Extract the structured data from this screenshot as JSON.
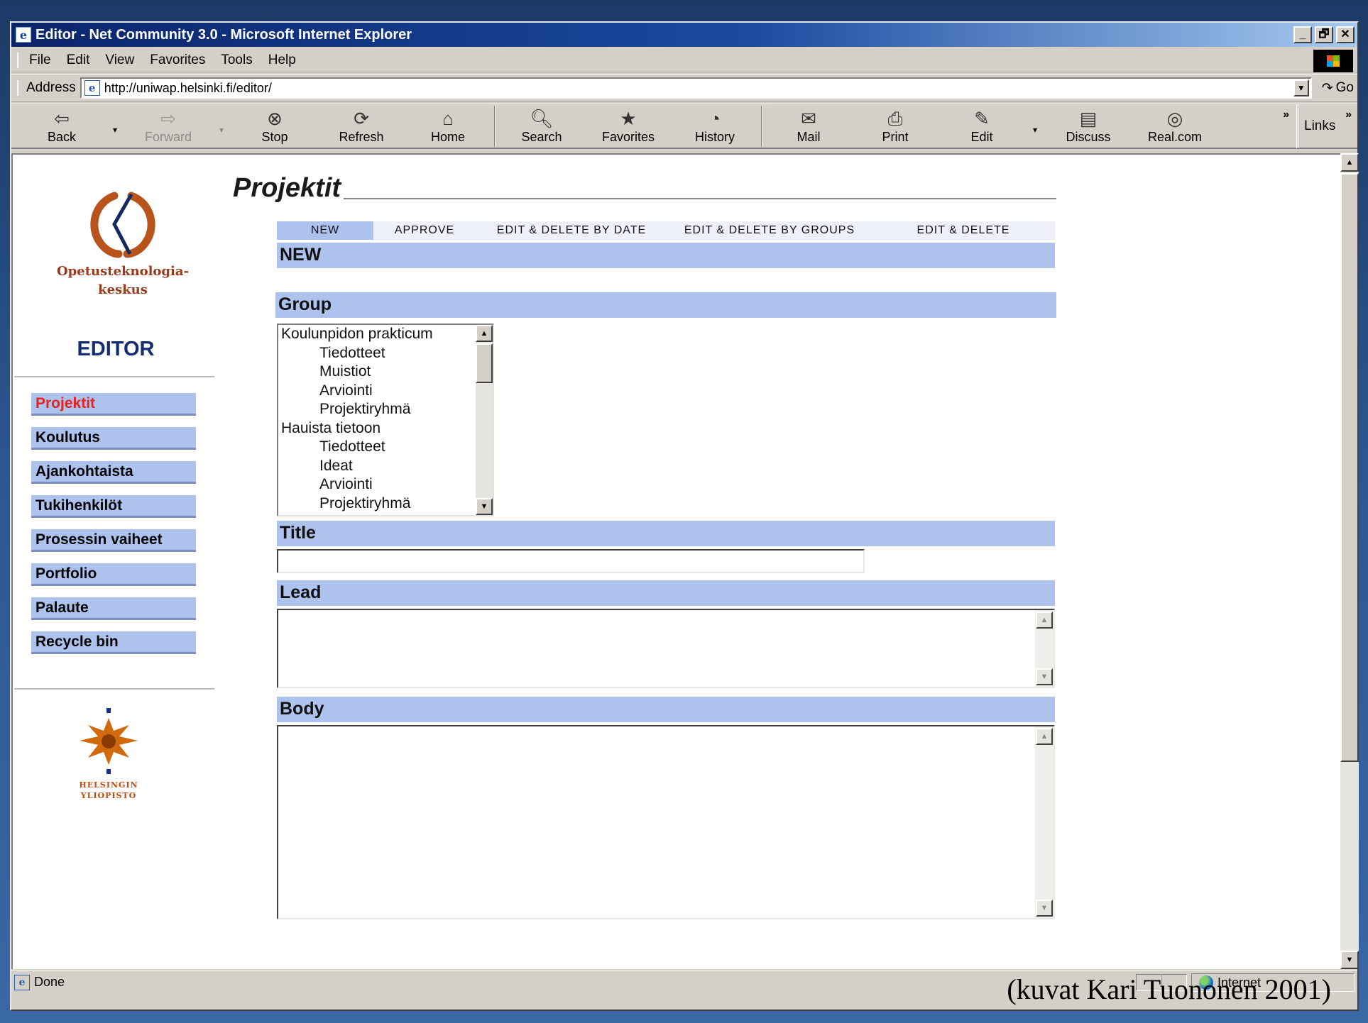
{
  "window": {
    "title": "Editor - Net Community 3.0 - Microsoft Internet Explorer",
    "buttons": [
      "_",
      "🗗",
      "✕"
    ]
  },
  "menubar": [
    "File",
    "Edit",
    "View",
    "Favorites",
    "Tools",
    "Help"
  ],
  "address": {
    "label": "Address",
    "url": "http://uniwap.helsinki.fi/editor/",
    "go_label": "Go"
  },
  "toolbar": {
    "back": "Back",
    "forward": "Forward",
    "stop": "Stop",
    "refresh": "Refresh",
    "home": "Home",
    "search": "Search",
    "favorites": "Favorites",
    "history": "History",
    "mail": "Mail",
    "print": "Print",
    "edit": "Edit",
    "discuss": "Discuss",
    "realcom": "Real.com",
    "links": "Links",
    "more": "»"
  },
  "sidebar": {
    "logo_line1": "Opetusteknologia-",
    "logo_line2": "keskus",
    "editor_title": "EDITOR",
    "items": [
      {
        "label": "Projektit"
      },
      {
        "label": "Koulutus"
      },
      {
        "label": "Ajankohtaista"
      },
      {
        "label": "Tukihenkilöt"
      },
      {
        "label": "Prosessin vaiheet"
      },
      {
        "label": "Portfolio"
      },
      {
        "label": "Palaute"
      },
      {
        "label": "Recycle bin"
      }
    ],
    "uni_line1": "HELSINGIN",
    "uni_line2": "YLIOPISTO"
  },
  "main": {
    "heading": "Projektit",
    "tabs": [
      {
        "label": "NEW"
      },
      {
        "label": "APPROVE"
      },
      {
        "label": "EDIT & DELETE BY DATE"
      },
      {
        "label": "EDIT & DELETE BY GROUPS"
      },
      {
        "label": "EDIT & DELETE"
      }
    ],
    "section_new": "NEW",
    "section_group": "Group",
    "groups": [
      {
        "label": "Koulunpidon prakticum",
        "level": 0
      },
      {
        "label": "Tiedotteet",
        "level": 1
      },
      {
        "label": "Muistiot",
        "level": 1
      },
      {
        "label": "Arviointi",
        "level": 1
      },
      {
        "label": "Projektiryhmä",
        "level": 1
      },
      {
        "label": "Hauista tietoon",
        "level": 0
      },
      {
        "label": "Tiedotteet",
        "level": 1
      },
      {
        "label": "Ideat",
        "level": 1
      },
      {
        "label": "Arviointi",
        "level": 1
      },
      {
        "label": "Projektiryhmä",
        "level": 1
      }
    ],
    "section_title": "Title",
    "title_value": "",
    "section_lead": "Lead",
    "lead_value": "",
    "section_body": "Body",
    "body_value": ""
  },
  "status": {
    "text": "Done",
    "zone": "Internet"
  },
  "credit": "(kuvat Kari Tuononen 2001)"
}
